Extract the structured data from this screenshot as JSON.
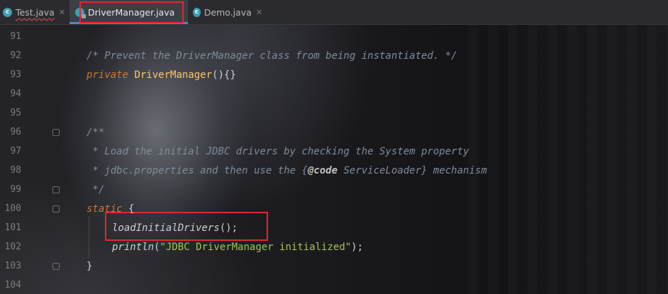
{
  "tabs": [
    {
      "label": "Test.java",
      "icon": "java-class-icon"
    },
    {
      "label": "DriverManager.java",
      "icon": "java-class-lock-icon"
    },
    {
      "label": "Demo.java",
      "icon": "java-class-icon"
    }
  ],
  "line_numbers": [
    "91",
    "92",
    "93",
    "94",
    "95",
    "96",
    "97",
    "98",
    "99",
    "100",
    "101",
    "102",
    "103",
    "104"
  ],
  "code": {
    "l92_comment": "/* Prevent the DriverManager class from being instantiated. */",
    "l93_private": "private",
    "l93_ctor": "DriverManager",
    "l93_rest": "(){}",
    "l96": "/**",
    "l97": " * Load the initial JDBC drivers by checking the System property",
    "l98_a": " * jdbc.properties and then use the {",
    "l98_tag": "@code",
    "l98_b": " ServiceLoader} mechanism",
    "l99": " */",
    "l100_kw": "static",
    "l100_rest": " {",
    "l101_fn": "loadInitialDrivers",
    "l101_rest": "();",
    "l102_fn": "println",
    "l102_open": "(",
    "l102_str": "\"JDBC DriverManager initialized\"",
    "l102_close": ");",
    "l103": "}"
  },
  "colors": {
    "highlight": "#e0282f",
    "keyword": "#cc7832",
    "comment": "#7f8c99",
    "string": "#a5c25c"
  }
}
